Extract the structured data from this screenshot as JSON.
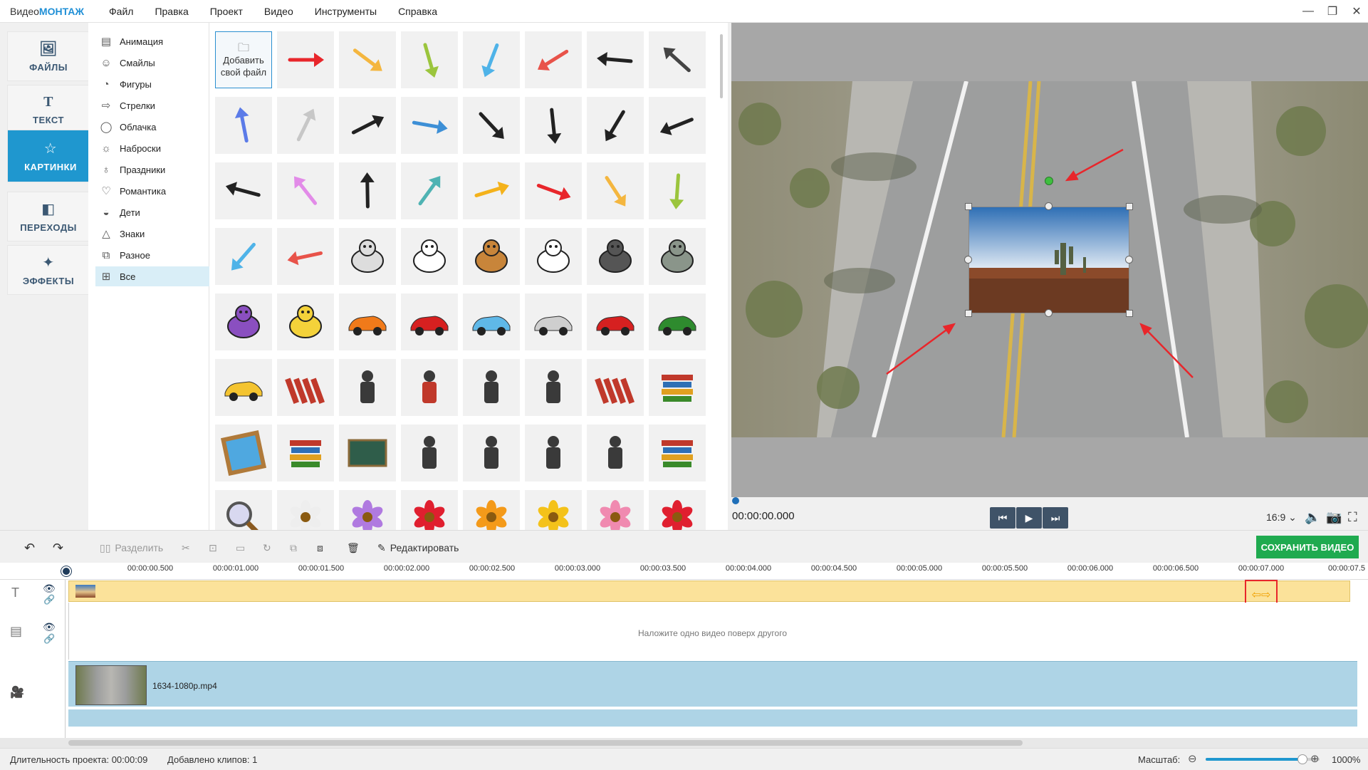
{
  "app": {
    "brand_a": "Видео",
    "brand_b": "МОНТАЖ"
  },
  "menu": [
    "Файл",
    "Правка",
    "Проект",
    "Видео",
    "Инструменты",
    "Справка"
  ],
  "window_controls": [
    "minimize-icon",
    "restore-icon",
    "close-icon"
  ],
  "nav": [
    {
      "label": "ФАЙЛЫ",
      "icon": "image-icon",
      "active": false
    },
    {
      "label": "ТЕКСТ",
      "icon": "text-icon",
      "active": false
    },
    {
      "label": "КАРТИНКИ",
      "icon": "star-icon",
      "active": true
    },
    {
      "label": "ПЕРЕХОДЫ",
      "icon": "transitions-icon",
      "active": false
    },
    {
      "label": "ЭФФЕКТЫ",
      "icon": "wand-icon",
      "active": false
    }
  ],
  "categories": [
    {
      "label": "Анимация",
      "icon": "film-icon"
    },
    {
      "label": "Смайлы",
      "icon": "smiley-icon"
    },
    {
      "label": "Фигуры",
      "icon": "shapes-icon"
    },
    {
      "label": "Стрелки",
      "icon": "arrow-icon"
    },
    {
      "label": "Облачка",
      "icon": "speech-bubble-icon"
    },
    {
      "label": "Наброски",
      "icon": "sun-icon"
    },
    {
      "label": "Праздники",
      "icon": "balloon-icon"
    },
    {
      "label": "Романтика",
      "icon": "heart-icon"
    },
    {
      "label": "Дети",
      "icon": "duck-icon"
    },
    {
      "label": "Знаки",
      "icon": "warning-icon"
    },
    {
      "label": "Разное",
      "icon": "misc-icon"
    },
    {
      "label": "Все",
      "icon": "grid-icon",
      "active": true
    }
  ],
  "library": {
    "add_label_1": "Добавить",
    "add_label_2": "свой файл",
    "items": [
      "arrow-zigzag-red-icon",
      "arrow-curved-yellow-icon",
      "arrow-up-green-icon",
      "arrow-trend-blue-icon",
      "arrow-up-red-icon",
      "arrow-sketch-curve-icon",
      "arrow-thin-curve-icon",
      "arrow-undo-icon",
      "cursor-click-icon",
      "arrow-return-blue-icon",
      "arrow-dotted-down-icon",
      "arrow-swoosh-black-icon",
      "arrow-left-blue-icon",
      "arrow-dashed-bold-icon",
      "arrow-dashed-curve-icon",
      "arrow-right-icon",
      "arrow-outline-right-icon",
      "arrow-hook-right-icon",
      "arrow-long-curve-icon",
      "arrow-pink-curve-icon",
      "arrow-u-turn-icon",
      "arrow-diagonal-teal-icon",
      "arrow-up-yellow-icon",
      "arrow-thin-up-icon",
      "arrow-dotted-diagonal-icon",
      "zebra-icon",
      "cow-icon",
      "dog-collie-icon",
      "dalmatian-icon",
      "husky-icon",
      "elephant-icon",
      "bird-purple-icon",
      "dog-cartoon-icon",
      "car-orange-icon",
      "car-red-sport-icon",
      "car-blue-icon",
      "car-silver-icon",
      "car-red-icon",
      "car-green-icon",
      "car-yellow-icon",
      "lipsticks-icon",
      "eyeshadow-icon",
      "woman-red-icon",
      "brush-icon",
      "compact-powder-icon",
      "lipstick-mirror-icon",
      "book-open-icon",
      "picture-frame-icon",
      "books-icon",
      "chalkboard-icon",
      "person-door-icon",
      "teacher-board-icon",
      "teacher-icon",
      "student-desk-icon",
      "book-stack-icon",
      "magnifier-icon",
      "flower-white-icon",
      "flower-purple-icon",
      "flower-red-icon",
      "flower-orange-icon",
      "sunflower-icon",
      "rose-pink-icon",
      "rose-red-icon"
    ]
  },
  "player": {
    "timecode": "00:00:00.000",
    "aspect": "16:9",
    "controls": [
      "skip-back-icon",
      "play-icon",
      "skip-forward-icon"
    ],
    "right_icons": [
      "volume-icon",
      "camera-icon",
      "fullscreen-icon"
    ]
  },
  "toolbar": {
    "split": "Разделить",
    "edit": "Редактировать",
    "save": "СОХРАНИТЬ ВИДЕО"
  },
  "ruler": [
    "00:00:00.500",
    "00:00:01.000",
    "00:00:01.500",
    "00:00:02.000",
    "00:00:02.500",
    "00:00:03.000",
    "00:00:03.500",
    "00:00:04.000",
    "00:00:04.500",
    "00:00:05.000",
    "00:00:05.500",
    "00:00:06.000",
    "00:00:06.500",
    "00:00:07.000",
    "00:00:07.5"
  ],
  "timeline": {
    "overlay_hint": "Наложите одно видео поверх другого",
    "clip_name": "1634-1080p.mp4"
  },
  "status": {
    "duration_label": "Длительность проекта:",
    "duration": "00:00:09",
    "clips_label": "Добавлено клипов:",
    "clips": "1",
    "zoom_label": "Масштаб:",
    "zoom": "1000%",
    "zoom_level": 0.85
  },
  "colors": {
    "accent": "#1f97cf",
    "save": "#1faa4f",
    "annotation": "#e8262b",
    "text_track": "#fbe29a",
    "video_track": "#aed4e6"
  }
}
